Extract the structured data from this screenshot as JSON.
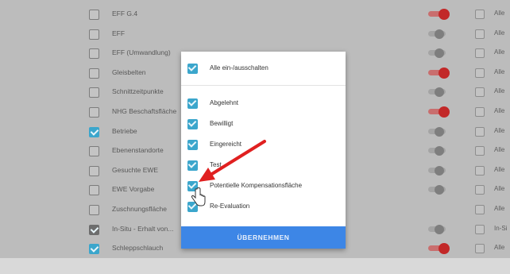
{
  "layers": [
    {
      "label": "EFF G.4",
      "checked": false,
      "toggle": "on",
      "right": "Alle"
    },
    {
      "label": "EFF",
      "checked": false,
      "toggle": "off",
      "right": "Alle"
    },
    {
      "label": "EFF (Umwandlung)",
      "checked": false,
      "toggle": "off",
      "right": "Alle"
    },
    {
      "label": "Gleisbelten",
      "checked": false,
      "toggle": "on",
      "right": "Alle"
    },
    {
      "label": "Schnittzeitpunkte",
      "checked": false,
      "toggle": "off",
      "right": "Alle"
    },
    {
      "label": "NHG Beschaftsfläche",
      "checked": false,
      "toggle": "on",
      "right": "Alle"
    },
    {
      "label": "Betriebe",
      "checked": true,
      "toggle": "off",
      "right": "Alle"
    },
    {
      "label": "Ebenenstandorte",
      "checked": false,
      "toggle": "off",
      "right": "Alle"
    },
    {
      "label": "Gesuchte EWE",
      "checked": false,
      "toggle": "off",
      "right": "Alle"
    },
    {
      "label": "EWE Vorgabe",
      "checked": false,
      "toggle": "off",
      "right": "Alle"
    },
    {
      "label": "Zuschnungsfläche",
      "checked": false,
      "toggle": "none",
      "right": "Alle"
    },
    {
      "label": "In-Situ - Erhalt von...",
      "checked": true,
      "dark": true,
      "toggle": "off",
      "right": "In-Si"
    },
    {
      "label": "Schleppschlauch",
      "checked": true,
      "toggle": "on",
      "right": "Alle"
    }
  ],
  "modal": {
    "select_all": "Alle ein-/ausschalten",
    "items": [
      "Abgelehnt",
      "Bewilligt",
      "Eingereicht",
      "Test",
      "Potentielle Kompensationsfläche",
      "Re-Evaluation"
    ],
    "apply_label": "ÜBERNEHMEN"
  },
  "colors": {
    "accent": "#3ba6cc",
    "toggle_on": "#c22828",
    "apply_button": "#3d86e6",
    "arrow": "#e02020"
  }
}
